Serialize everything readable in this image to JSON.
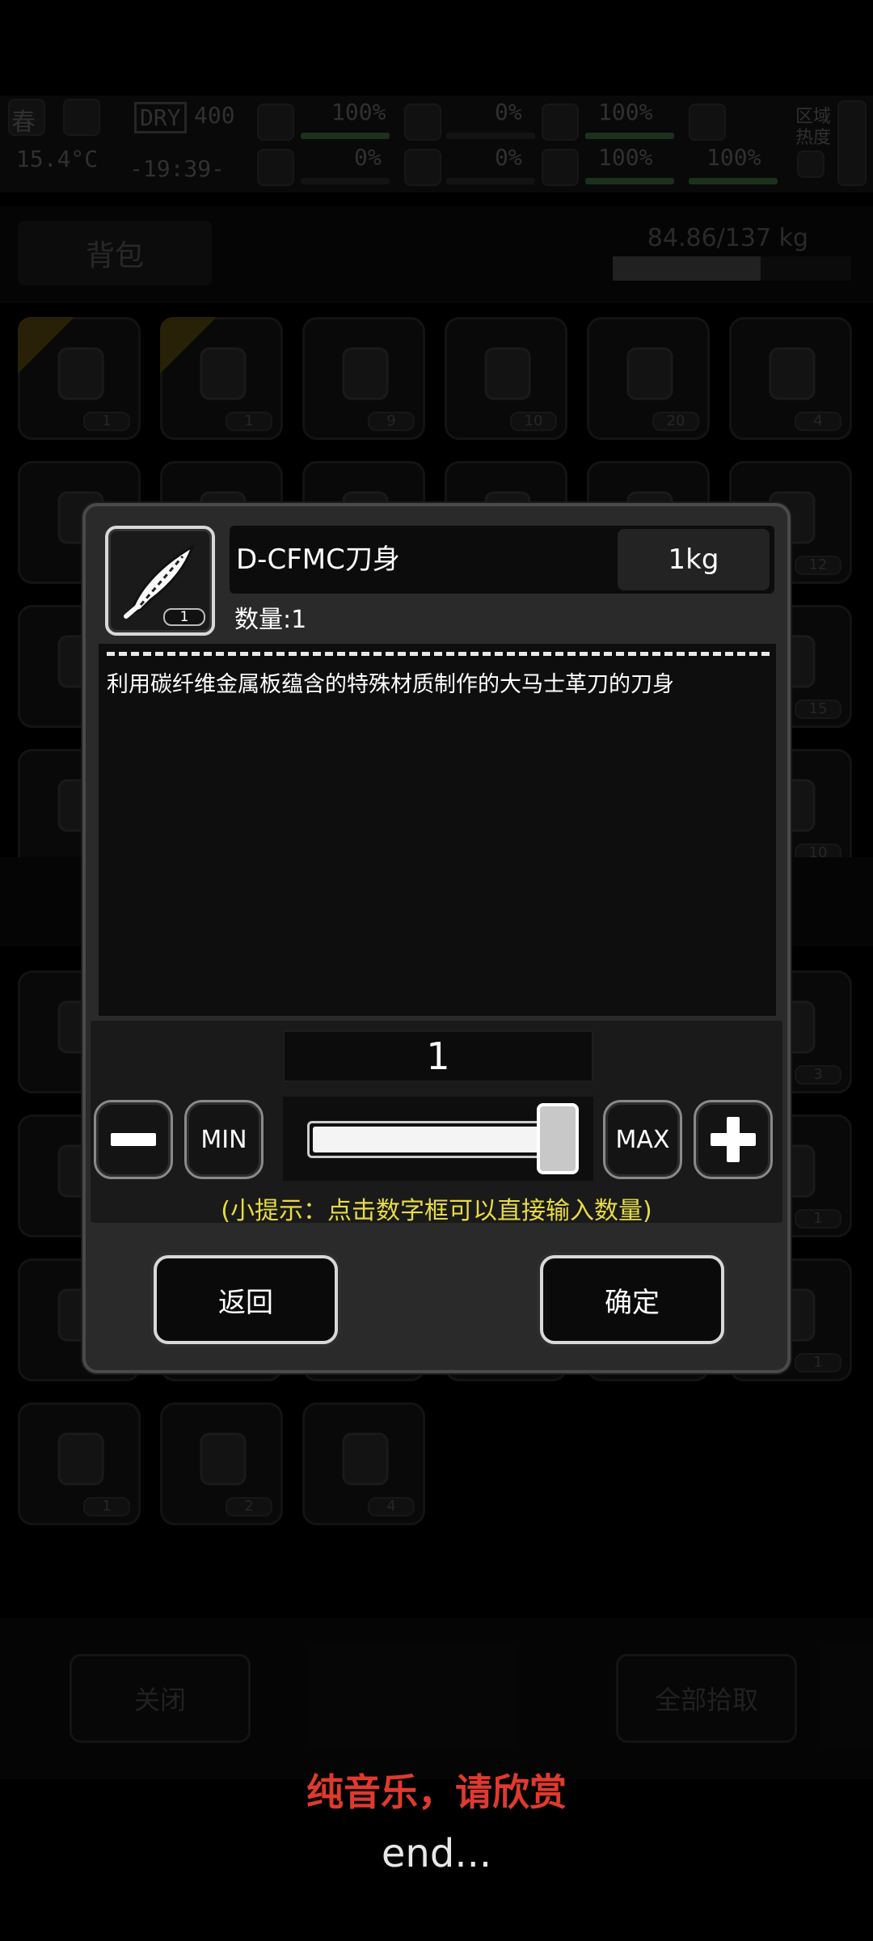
{
  "hud": {
    "season": "春",
    "temperature": "15.4°C",
    "dry_tag": "DRY",
    "dry_value": "400",
    "clock": "-19:39-",
    "stats": [
      {
        "label": "100%",
        "value": 1.0
      },
      {
        "label": "0%",
        "value": 0.0
      },
      {
        "label": "0%",
        "value": 0.0
      },
      {
        "label": "0%",
        "value": 0.0
      },
      {
        "label": "100%",
        "value": 1.0
      },
      {
        "label": "100%",
        "value": 1.0
      },
      {
        "label": "100%",
        "value": 1.0
      }
    ],
    "area_heat": "区域\n热度"
  },
  "backpack": {
    "tab_label": "背包",
    "weight_text": "84.86/137 kg",
    "weight_fraction": 0.62,
    "rows": [
      {
        "counts": [
          "1",
          "1",
          "9",
          "10",
          "20",
          "4"
        ]
      },
      {
        "counts": [
          "",
          "",
          "",
          "",
          "",
          "12"
        ]
      },
      {
        "counts": [
          "",
          "",
          "",
          "",
          "",
          "15"
        ]
      },
      {
        "counts": [
          "",
          "",
          "",
          "",
          "",
          "10"
        ]
      },
      {
        "counts": [
          "",
          "",
          "",
          "",
          "",
          "3"
        ]
      },
      {
        "counts": [
          "",
          "",
          "",
          "",
          "",
          "1"
        ]
      },
      {
        "counts": [
          "",
          "",
          "",
          "",
          "",
          "1"
        ]
      },
      {
        "counts": [
          "1",
          "2",
          "4"
        ]
      }
    ]
  },
  "footer": {
    "close_label": "关闭",
    "pickup_all_label": "全部拾取"
  },
  "dialog": {
    "item_name": "D-CFMC刀身",
    "item_weight": "1kg",
    "count_text": "数量:1",
    "thumb_count": "1",
    "description": "利用碳纤维金属板蕴含的特殊材质制作的大马士革刀的刀身",
    "quantity": "1",
    "slider_fraction": 1.0,
    "min_label": "MIN",
    "max_label": "MAX",
    "hint": "(小提示：点击数字框可以直接输入数量)",
    "back_label": "返回",
    "confirm_label": "确定"
  },
  "overlay_subtitles": {
    "line1": "纯音乐，请欣赏",
    "line2": "end..."
  },
  "colors": {
    "hint": "#e8dc44",
    "subtitle_red": "#e03a2e",
    "dialog_bg": "#2a2a2a"
  }
}
